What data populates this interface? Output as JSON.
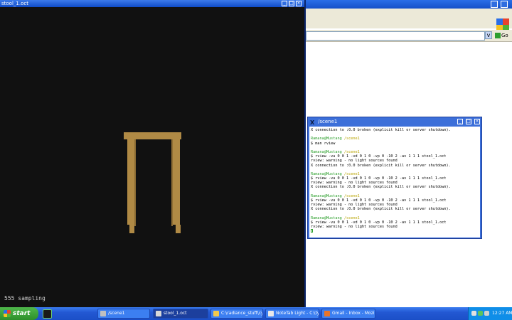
{
  "rview": {
    "title": "stool_1.oct",
    "status": "555 sampling",
    "buttons": {
      "minimize": "_",
      "maximize": "□",
      "close": "×"
    }
  },
  "browser": {
    "go_label": "Go",
    "dropdown": "v"
  },
  "xterm": {
    "title": "/scene1",
    "buttons": {
      "minimize": "_",
      "maximize": "□",
      "close": "×"
    },
    "lines": [
      {
        "text": "X connection to :0.0 broken (explicit kill or server shutdown).",
        "style": ""
      },
      {
        "text": "",
        "style": "blank"
      },
      {
        "user": "Ramana@Mustang",
        "path": " /scene1"
      },
      {
        "text": "$ man rview",
        "style": ""
      },
      {
        "text": "",
        "style": "blank"
      },
      {
        "user": "Ramana@Mustang",
        "path": " /scene1"
      },
      {
        "text": "$ rview -vu 0 0 1 -vd 0 1 0 -vp 0 -10 2 -av 1 1 1 stool_1.oct",
        "style": ""
      },
      {
        "text": "rview: warning - no light sources found",
        "style": ""
      },
      {
        "text": "X connection to :0.0 broken (explicit kill or server shutdown).",
        "style": ""
      },
      {
        "text": "",
        "style": "blank"
      },
      {
        "user": "Ramana@Mustang",
        "path": " /scene1"
      },
      {
        "text": "$ rview -vu 0 0 1 -vd 0 1 0 -vp 0 -10 2 -av 1 1 1 stool_1.oct",
        "style": ""
      },
      {
        "text": "rview: warning - no light sources found",
        "style": ""
      },
      {
        "text": "X connection to :0.0 broken (explicit kill or server shutdown).",
        "style": ""
      },
      {
        "text": "",
        "style": "blank"
      },
      {
        "user": "Ramana@Mustang",
        "path": " /scene1"
      },
      {
        "text": "$ rview -vu 0 0 1 -vd 0 1 0 -vp 0 -10 2 -av 1 1 1 stool_1.oct",
        "style": ""
      },
      {
        "text": "rview: warning - no light sources found",
        "style": ""
      },
      {
        "text": "X connection to :0.0 broken (explicit kill or server shutdown).",
        "style": ""
      },
      {
        "text": "",
        "style": "blank"
      },
      {
        "user": "Ramana@Mustang",
        "path": " /scene1"
      },
      {
        "text": "$ rview -vu 0 0 1 -vd 0 1 0 -vp 0 -10 2 -av 1 1 1 stool_1.oct",
        "style": ""
      },
      {
        "text": "rview: warning - no light sources found",
        "style": ""
      },
      {
        "text": "",
        "style": "cursor"
      }
    ]
  },
  "taskbar": {
    "start_label": "start",
    "tasks": [
      {
        "label": "/scene1",
        "icon": "x-terminal-icon",
        "color": "#c0c0c0",
        "active": false
      },
      {
        "label": "stool_1.oct",
        "icon": "x-window-icon",
        "color": "#d8d8d8",
        "active": true
      },
      {
        "label": "C:\\radiance_stuff\\cy...",
        "icon": "folder-icon",
        "color": "#f2c94c",
        "active": false
      },
      {
        "label": "NoteTab Light - C:\\ty...",
        "icon": "notepad-icon",
        "color": "#e8e8e8",
        "active": false
      },
      {
        "label": "Gmail - Inbox - Mozilla...",
        "icon": "firefox-icon",
        "color": "#e8742a",
        "active": false
      }
    ],
    "clock": "12:27 AM"
  },
  "colors": {
    "stool": "#b08a45",
    "render_bg": "#111111",
    "prompt_green": "#2ea02e",
    "prompt_yellow": "#b8a400"
  }
}
